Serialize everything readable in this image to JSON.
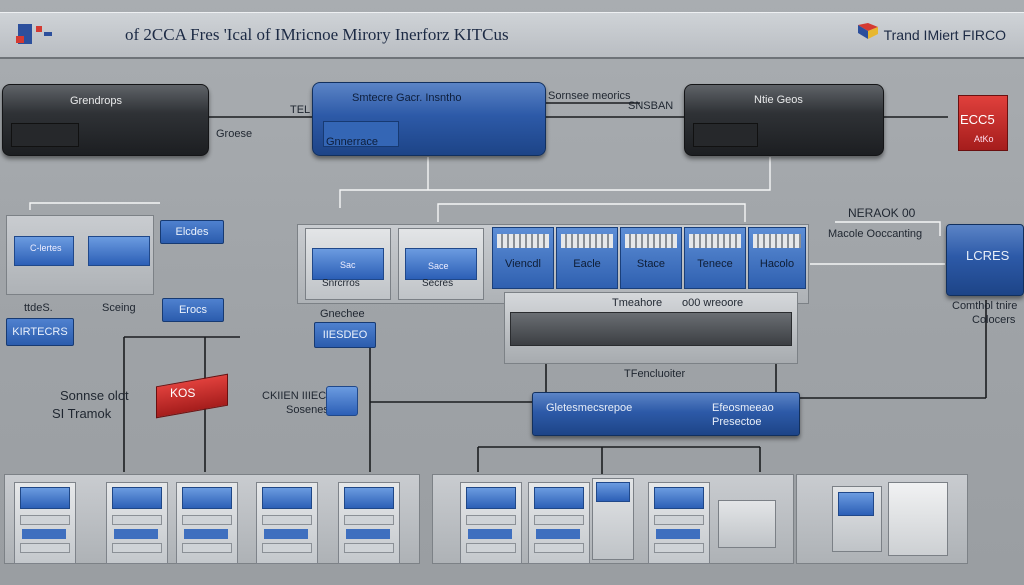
{
  "header": {
    "title": "of 2CCA  Fres  'Ical of IMricnoe Mirory Inerforz KITCus",
    "brand": "Trand IMiert FIRCO"
  },
  "top_row": {
    "left_server": "Grendrops",
    "left_caption": "Groese",
    "mid_label_left": "TEL",
    "center_server_top": "Smtecre Gacr. Insntho",
    "center_server_bottom": "Gnnerrace",
    "center_right_label1": "Sornsee meorics",
    "center_right_label2": "SNSBAN",
    "right_server": "Ntie Geos",
    "red_box_top": "ECC5",
    "red_box_bottom": "AtKo"
  },
  "middle_row": {
    "left_screen": "C-lertes",
    "left_tile": "Elcdes",
    "left_label_a": "ttdeS.",
    "left_label_b": "Sceing",
    "left_tile2": "Erocs",
    "left_badge": "KIRTECRS",
    "unit1": "Sac",
    "unit1_caption": "Snrcrros",
    "unit2": "Sace",
    "unit2_caption": "Secres",
    "rack1": "Viencdl",
    "rack2": "Eacle",
    "rack3": "Stace",
    "rack4": "Tenece",
    "rack5": "Hacolo",
    "right_label1": "NERAOK 00",
    "right_label2": "Macole Ooccanting",
    "right_server": "LCRES",
    "right_caption1": "Comthol tnire",
    "right_caption2": "Colocers",
    "center_caption": "Gnechee",
    "center_badge": "IIESDEO",
    "panel_label1": "Tmeahore",
    "panel_label2": "o00 wreoore"
  },
  "lower_row": {
    "left_text1": "Sonnse olot",
    "left_text2": "SI Tramok",
    "red_cube": "KOS",
    "mid_text1": "CKIIEN IIIEC",
    "mid_text2": "Sosenes",
    "transformer_label": "TFencluoiter",
    "switch_label": "Gletesmecsrepoe",
    "switch_label2": "Efeosmeeao",
    "switch_label3": "Presectoe"
  },
  "colors": {
    "accent_blue": "#2f60b0",
    "dark_server": "#2a2c30",
    "red": "#c42a26",
    "background": "#a3a7ab"
  }
}
